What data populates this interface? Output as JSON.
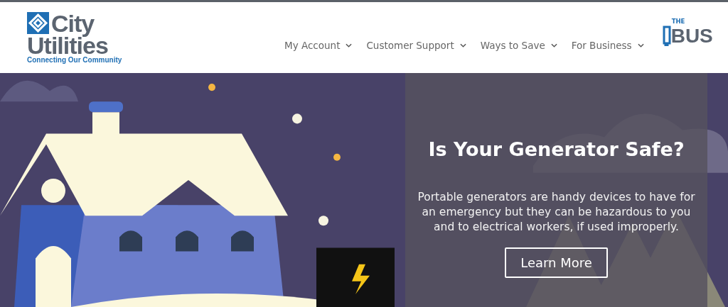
{
  "header": {
    "logo": {
      "line_1": "City",
      "line_2": "Utilities",
      "tagline": "Connecting Our Community"
    },
    "nav": [
      {
        "label": "My Account"
      },
      {
        "label": "Customer Support"
      },
      {
        "label": "Ways to Save"
      },
      {
        "label": "For Business"
      }
    ],
    "bus_logo": {
      "small": "THE",
      "large": "BUS"
    }
  },
  "hero": {
    "kind": "picture",
    "title": "Is Your Generator Safe?",
    "text": "Portable generators are handy devices to have for an emergency but they can be hazardous to you and to electrical workers, if used improperly.",
    "button": "Learn More"
  }
}
